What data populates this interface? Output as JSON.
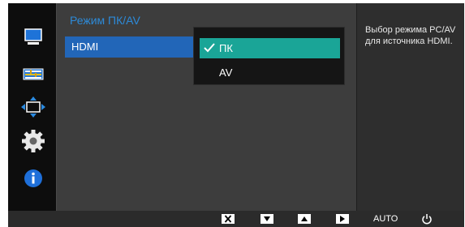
{
  "sidebar": {
    "items": [
      {
        "icon": "monitor-icon"
      },
      {
        "icon": "adjust-sliders-icon"
      },
      {
        "icon": "screen-position-icon"
      },
      {
        "icon": "settings-gear-icon"
      },
      {
        "icon": "info-icon"
      }
    ]
  },
  "panel": {
    "title": "Режим ПК/AV",
    "selected_item": "HDMI",
    "dropdown": {
      "options": [
        {
          "label": "ПК",
          "selected": true
        },
        {
          "label": "AV",
          "selected": false
        }
      ]
    }
  },
  "help": {
    "text": "Выбор режима PC/AV для источника HDMI."
  },
  "buttonbar": {
    "buttons": [
      {
        "icon": "close-icon"
      },
      {
        "icon": "arrow-down-icon"
      },
      {
        "icon": "arrow-up-icon"
      },
      {
        "icon": "arrow-right-icon"
      },
      {
        "label": "AUTO"
      },
      {
        "icon": "power-icon"
      }
    ]
  },
  "colors": {
    "title_blue": "#2d8ad8",
    "highlight_blue": "#2266b8",
    "selected_teal": "#1aa597",
    "info_blue": "#1e6fd9"
  }
}
